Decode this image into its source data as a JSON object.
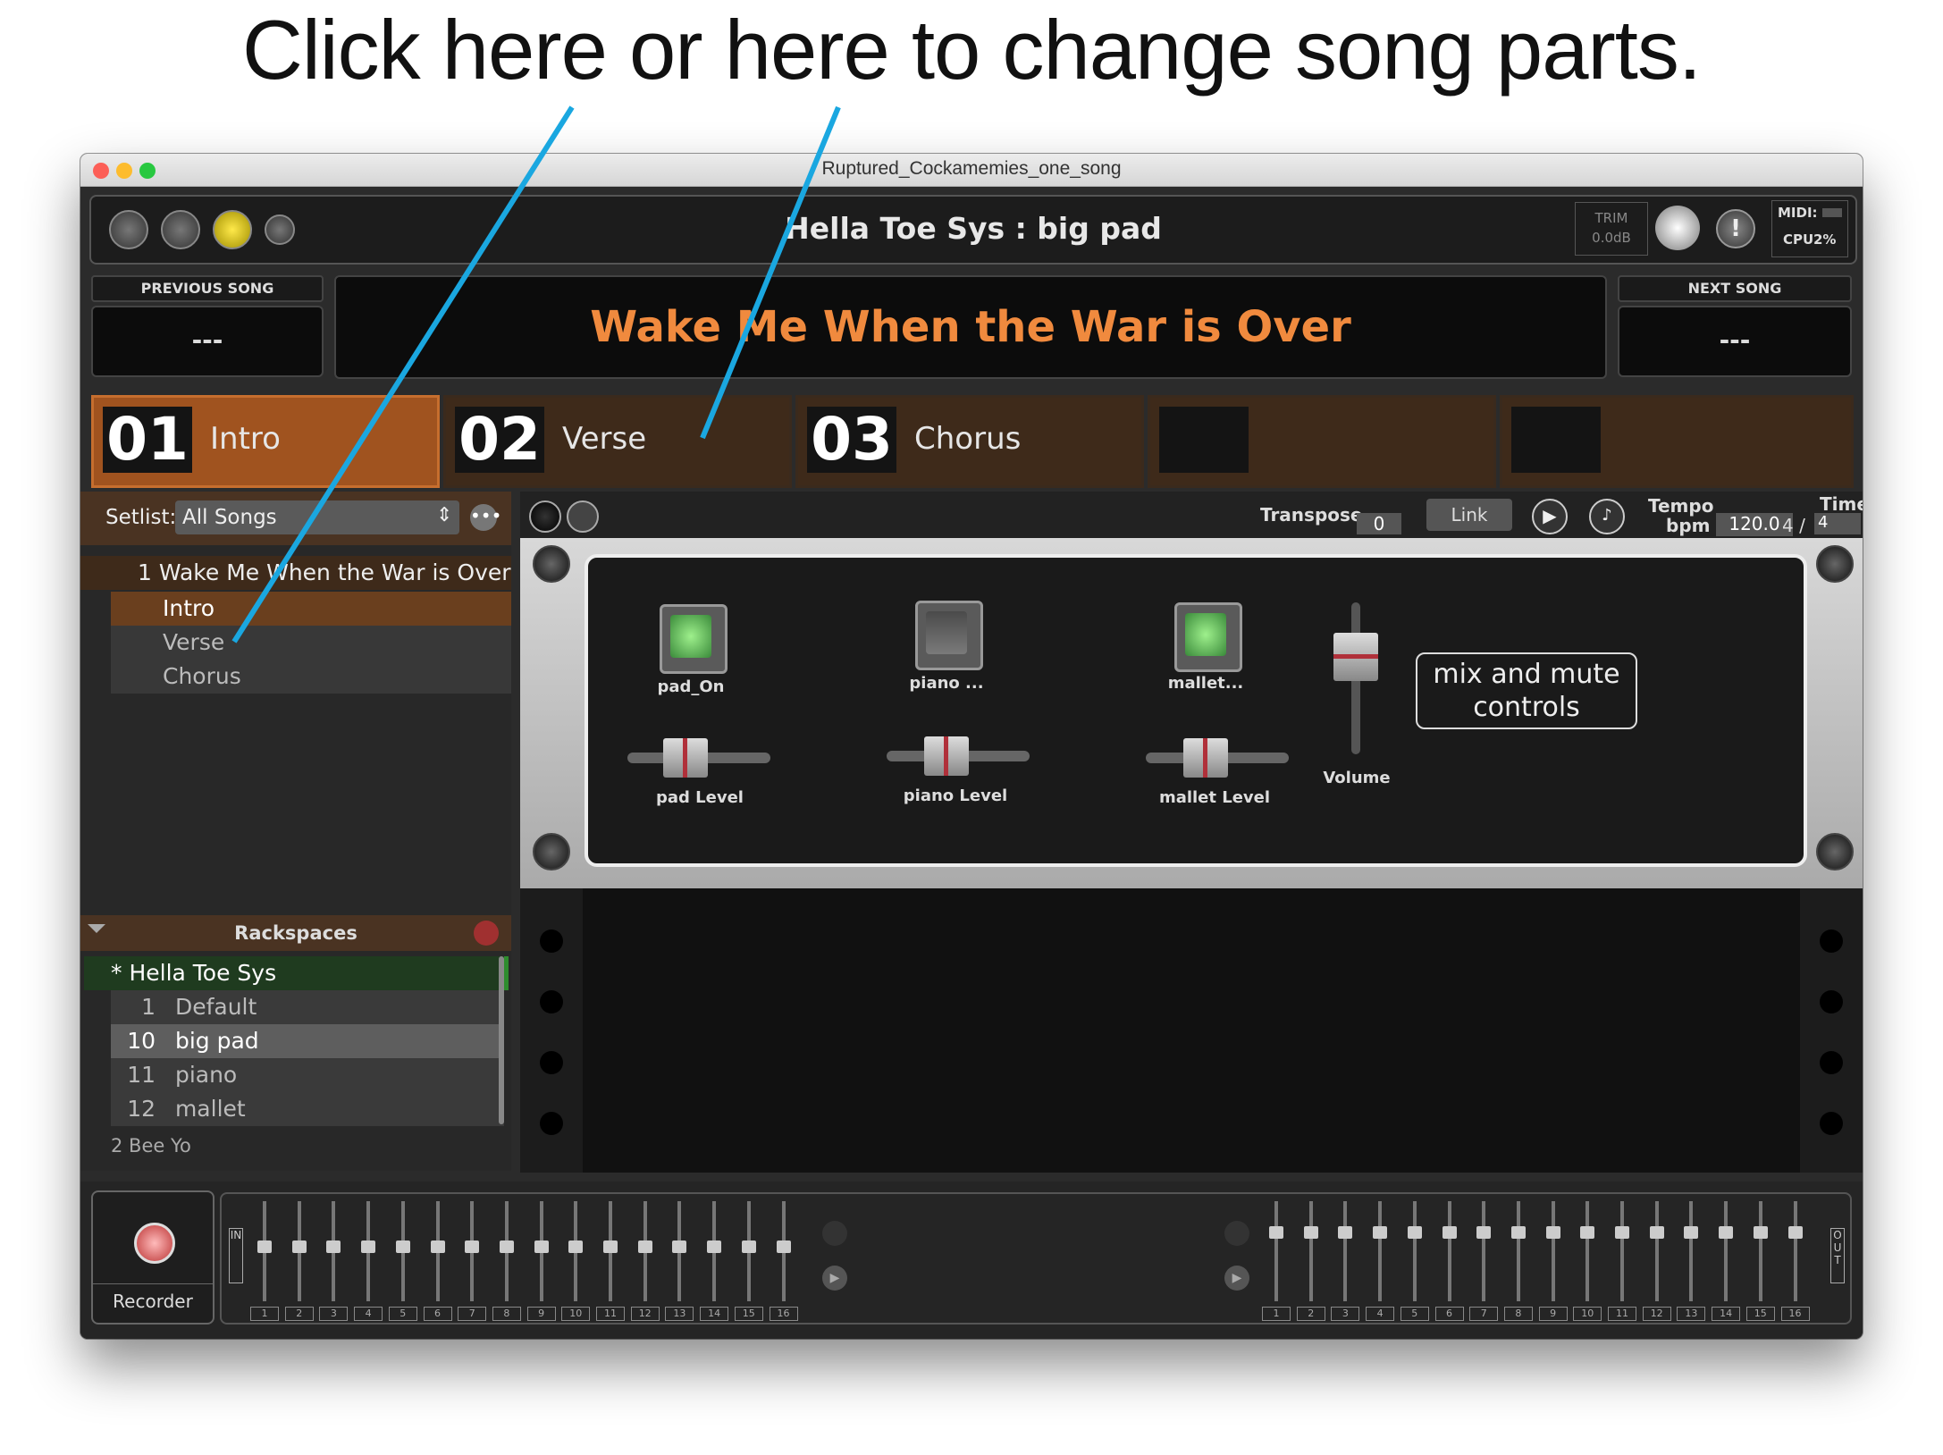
{
  "caption": "Click here or here to change song parts.",
  "window": {
    "title": "Ruptured_Cockamemies_one_song",
    "rackspace_title": "Hella Toe Sys : big pad",
    "trim_label": "TRIM",
    "trim_value": "0.0dB",
    "midi_label": "MIDI:",
    "cpu_label": "CPU",
    "cpu_value": "2%"
  },
  "songs": {
    "previous_label": "PREVIOUS SONG",
    "previous_value": "---",
    "current": "Wake Me When the War is Over",
    "next_label": "NEXT SONG",
    "next_value": "---"
  },
  "parts": [
    {
      "num": "01",
      "name": "Intro"
    },
    {
      "num": "02",
      "name": "Verse"
    },
    {
      "num": "03",
      "name": "Chorus"
    }
  ],
  "setlist": {
    "label": "Setlist:",
    "value": "All Songs",
    "song1": "1 Wake Me When the War is Over",
    "song1_parts": [
      "Intro",
      "Verse",
      "Chorus"
    ],
    "song2": "2 Bee Yo"
  },
  "rackspaces": {
    "header": "Rackspaces",
    "system": "* Hella Toe Sys",
    "items": [
      {
        "num": "1",
        "name": "Default"
      },
      {
        "num": "10",
        "name": "big pad"
      },
      {
        "num": "11",
        "name": "piano"
      },
      {
        "num": "12",
        "name": "mallet"
      }
    ]
  },
  "transport": {
    "transpose_label": "Transpose",
    "transpose_value": "0",
    "link_label": "Link",
    "tempo_label": "Tempo",
    "bpm_label": "bpm",
    "tempo_value": "120.0",
    "time_label": "Time",
    "time_num": "4 /",
    "time_den": "4"
  },
  "panel": {
    "widgets": [
      {
        "button": "pad_On",
        "slider": "pad Level",
        "led_on": true
      },
      {
        "button": "piano ...",
        "slider": "piano Level",
        "led_on": false
      },
      {
        "button": "mallet...",
        "slider": "mallet Level",
        "led_on": true
      }
    ],
    "volume_label": "Volume",
    "note": "mix and mute controls"
  },
  "bottom": {
    "recorder_label": "Recorder",
    "in_label": "IN",
    "out_label": "OUT",
    "channels": [
      "1",
      "2",
      "3",
      "4",
      "5",
      "6",
      "7",
      "8",
      "9",
      "10",
      "11",
      "12",
      "13",
      "14",
      "15",
      "16"
    ]
  },
  "colors": {
    "accent_orange": "#f08a3e",
    "selected_part": "#a0531f",
    "callout_line": "#1aa7e0"
  }
}
